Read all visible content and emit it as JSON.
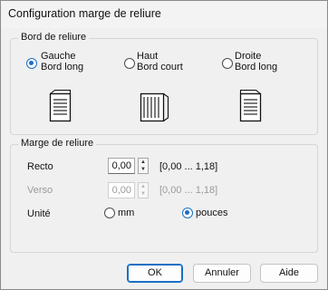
{
  "dialog": {
    "title": "Configuration marge de reliure"
  },
  "binding_edge": {
    "label": "Bord de reliure",
    "options": [
      {
        "line1": "Gauche",
        "line2": "Bord long",
        "selected": true,
        "icon": "left-bound-page-icon"
      },
      {
        "line1": "Haut",
        "line2": "Bord court",
        "selected": false,
        "icon": "top-bound-page-icon"
      },
      {
        "line1": "Droite",
        "line2": "Bord long",
        "selected": false,
        "icon": "right-bound-page-icon"
      }
    ]
  },
  "margin": {
    "label": "Marge de reliure",
    "recto": {
      "label": "Recto",
      "value": "0,00",
      "range": "[0,00 ... 1,18]",
      "enabled": true
    },
    "verso": {
      "label": "Verso",
      "value": "0,00",
      "range": "[0,00 ... 1,18]",
      "enabled": false
    },
    "unit": {
      "label": "Unité",
      "options": [
        {
          "label": "mm",
          "selected": false
        },
        {
          "label": "pouces",
          "selected": true
        }
      ]
    }
  },
  "buttons": {
    "ok": "OK",
    "cancel": "Annuler",
    "help": "Aide"
  },
  "colors": {
    "accent": "#1a6fc4",
    "dialog_bg": "#f0f0f0",
    "disabled_text": "#9a9a9a"
  }
}
